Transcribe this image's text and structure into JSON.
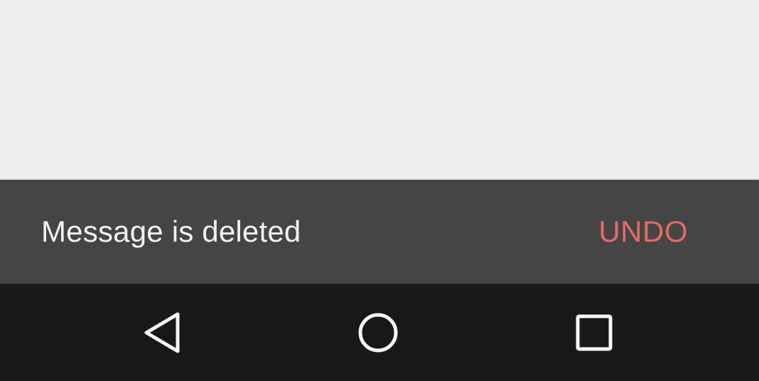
{
  "snackbar": {
    "message": "Message is deleted",
    "action_label": "UNDO",
    "action_color": "#e46a66"
  },
  "navbar": {
    "buttons": [
      {
        "icon": "back-triangle-icon"
      },
      {
        "icon": "home-circle-icon"
      },
      {
        "icon": "recents-square-icon"
      }
    ]
  },
  "colors": {
    "content_background": "#efefef",
    "snackbar_background": "#454545",
    "navbar_background": "#181818",
    "icon_color": "#f5f5f5"
  }
}
